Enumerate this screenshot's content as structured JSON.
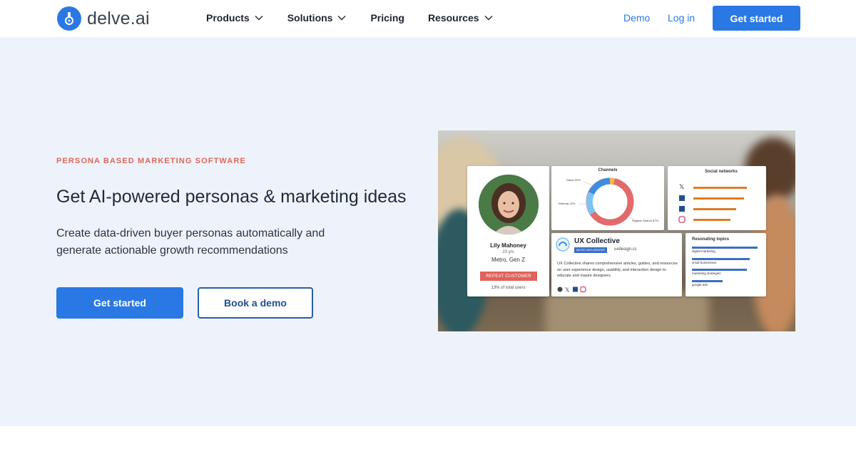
{
  "brand": {
    "name": "delve.ai",
    "color": "#2a78e4"
  },
  "nav": {
    "items": [
      {
        "label": "Products",
        "has_dropdown": true
      },
      {
        "label": "Solutions",
        "has_dropdown": true
      },
      {
        "label": "Pricing",
        "has_dropdown": false
      },
      {
        "label": "Resources",
        "has_dropdown": true
      }
    ],
    "demo_label": "Demo",
    "login_label": "Log in",
    "cta_label": "Get started"
  },
  "hero": {
    "eyebrow": "PERSONA BASED MARKETING SOFTWARE",
    "headline": "Get AI-powered personas & marketing ideas",
    "subtext": "Create data-driven buyer personas automatically and generate actionable growth recommendations",
    "primary_button": "Get started",
    "secondary_button": "Book a demo"
  },
  "dashboard": {
    "persona": {
      "name": "Lily Mahoney",
      "age": "23 yrs",
      "segment": "Metro, Gen Z",
      "badge": "REPEAT CUSTOMER",
      "share": "13% of total users"
    },
    "channels": {
      "title": "Channels",
      "labels": [
        "Direct 22%",
        "Referral 22%",
        "Organic Search 57%"
      ]
    },
    "social": {
      "title": "Social networks",
      "icons": [
        "x-icon",
        "facebook-icon",
        "linkedin-icon",
        "instagram-icon"
      ],
      "bar_levels": [
        0.75,
        0.71,
        0.6,
        0.52
      ]
    },
    "ux_collective": {
      "name": "UX Collective",
      "tag": "MICRO INFLUENCER",
      "domain": "uxdesign.cc",
      "description": "UX Collective shares comprehensive articles, guides, and resources on user experience design, usability, and interaction design to educate and inspire designers."
    },
    "topics": {
      "title": "Resonating topics",
      "items": [
        {
          "label": "digital marketing",
          "level": 0.98
        },
        {
          "label": "small businesses",
          "level": 0.86
        },
        {
          "label": "marketing strategies",
          "level": 0.82
        },
        {
          "label": "google ads",
          "level": 0.46
        }
      ]
    },
    "colors": {
      "accent": "#2a78e4",
      "alert": "#e0625a",
      "bar_orange": "#e07b26",
      "bar_blue": "#3a6fc4",
      "ring_red": "#e26a6a",
      "ring_blue": "#3e8de0"
    }
  }
}
